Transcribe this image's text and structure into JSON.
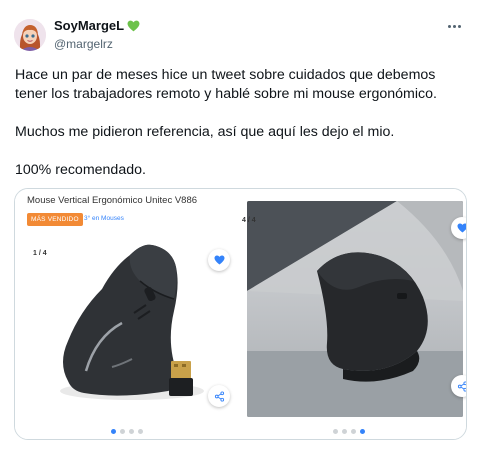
{
  "author": {
    "display_name": "SoyMargeL",
    "handle": "@margelrz",
    "avatar_icon": "avatar-illustration-icon",
    "badge_icon": "green-heart-icon",
    "badge_color": "#6cc24a"
  },
  "tweet": {
    "paragraphs": [
      "Hace un par de meses hice un tweet sobre cuidados que debemos tener los trabajadores remoto y hablé sobre mi mouse ergonómico.",
      "Muchos me pidieron referencia, así que aquí les dejo el mio.",
      "100% recomendado."
    ]
  },
  "more_icon": "more-options-icon",
  "media": {
    "left": {
      "title": "Mouse Vertical Ergonómico Unitec V886",
      "badge": "MÁS VENDIDO",
      "badge_color": "#f28a35",
      "rank": "3° en Mouses",
      "counter": "1 / 4",
      "fav_icon": "heart-icon",
      "share_icon": "share-icon",
      "dots_active_index": 0
    },
    "right": {
      "counter": "4 / 4",
      "fav_icon": "heart-icon",
      "share_icon": "share-icon",
      "dots_active_index": 3
    },
    "accent_color": "#3483fa"
  }
}
